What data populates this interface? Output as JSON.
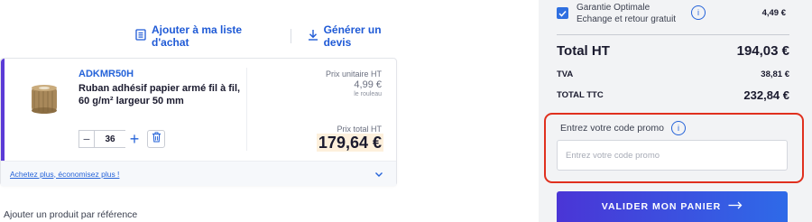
{
  "actions": {
    "add_to_list": "Ajouter à ma liste d'achat",
    "quote": "Générer un devis"
  },
  "product": {
    "ref": "ADKMR50H",
    "name": "Ruban adhésif papier armé fil à fil, 60 g/m² largeur 50 mm",
    "unit_price_label": "Prix unitaire HT",
    "unit_price": "4,99 €",
    "unit_sub": "le rouleau",
    "total_label": "Prix total HT",
    "total_price": "179,64 €",
    "quantity": "36",
    "footer_link": "Achetez plus, économisez plus !"
  },
  "add_by_ref": "Ajouter un produit par référence",
  "summary": {
    "guarantee_line1": "Garantie Optimale",
    "guarantee_line2": "Echange et retour gratuit",
    "guarantee_price": "4,49 €",
    "total_ht_label": "Total HT",
    "total_ht": "194,03 €",
    "tva_label": "TVA",
    "tva": "38,81 €",
    "total_ttc_label": "TOTAL TTC",
    "total_ttc": "232,84 €"
  },
  "promo": {
    "label": "Entrez votre code promo",
    "placeholder": "Entrez votre code promo",
    "value": ""
  },
  "validate_label": "VALIDER MON PANIER",
  "colors": {
    "accent": "#2563d9",
    "brand_purple": "#5b3bd6",
    "highlight": "#e0301e"
  },
  "icons": {
    "list": "list-icon",
    "download": "download-icon",
    "trash": "trash-icon",
    "chevron": "chevron-down-icon",
    "info": "info-icon",
    "check": "check-icon",
    "arrow": "arrow-right-icon"
  }
}
